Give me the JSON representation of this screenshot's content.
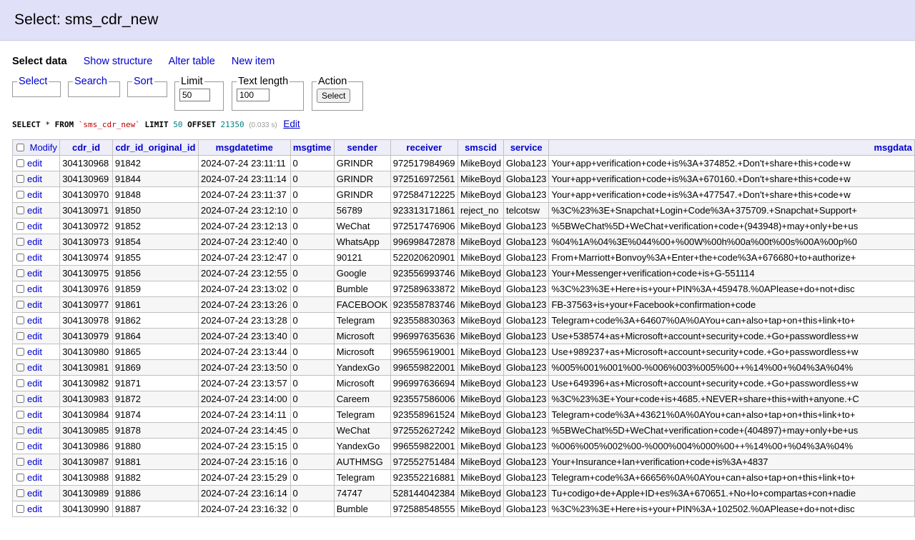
{
  "header": {
    "title": "Select: sms_cdr_new"
  },
  "nav": {
    "current": "Select data",
    "links": [
      "Show structure",
      "Alter table",
      "New item"
    ]
  },
  "fieldsets": {
    "select": "Select",
    "search": "Search",
    "sort": "Sort",
    "limit": {
      "label": "Limit",
      "value": "50"
    },
    "text_length": {
      "label": "Text length",
      "value": "100"
    },
    "action": {
      "label": "Action",
      "button": "Select"
    }
  },
  "query": {
    "kw_select": "SELECT",
    "star": "*",
    "kw_from": "FROM",
    "table": "`sms_cdr_new`",
    "kw_limit": "LIMIT",
    "limit": "50",
    "kw_offset": "OFFSET",
    "offset": "21350",
    "time": "(0.033 s)",
    "edit": "Edit"
  },
  "table": {
    "modify_label": "Modify",
    "edit_label": "edit",
    "columns": [
      "cdr_id",
      "cdr_id_original_id",
      "msgdatetime",
      "msgtime",
      "sender",
      "receiver",
      "smscid",
      "service",
      "msgdata"
    ],
    "rows": [
      [
        "304130968",
        "91842",
        "2024-07-24 23:11:11",
        "0",
        "GRINDR",
        "972517984969",
        "MikeBoyd",
        "Globa123",
        "Your+app+verification+code+is%3A+374852.+Don't+share+this+code+w"
      ],
      [
        "304130969",
        "91844",
        "2024-07-24 23:11:14",
        "0",
        "GRINDR",
        "972516972561",
        "MikeBoyd",
        "Globa123",
        "Your+app+verification+code+is%3A+670160.+Don't+share+this+code+w"
      ],
      [
        "304130970",
        "91848",
        "2024-07-24 23:11:37",
        "0",
        "GRINDR",
        "972584712225",
        "MikeBoyd",
        "Globa123",
        "Your+app+verification+code+is%3A+477547.+Don't+share+this+code+w"
      ],
      [
        "304130971",
        "91850",
        "2024-07-24 23:12:10",
        "0",
        "56789",
        "923313171861",
        "reject_no",
        "telcotsw",
        "%3C%23%3E+Snapchat+Login+Code%3A+375709.+Snapchat+Support+"
      ],
      [
        "304130972",
        "91852",
        "2024-07-24 23:12:13",
        "0",
        "WeChat",
        "972517476906",
        "MikeBoyd",
        "Globa123",
        "%5BWeChat%5D+WeChat+verification+code+(943948)+may+only+be+us"
      ],
      [
        "304130973",
        "91854",
        "2024-07-24 23:12:40",
        "0",
        "WhatsApp",
        "996998472878",
        "MikeBoyd",
        "Globa123",
        "%04%1A%04%3E%044%00+%00W%00h%00a%00t%00s%00A%00p%0"
      ],
      [
        "304130974",
        "91855",
        "2024-07-24 23:12:47",
        "0",
        "90121",
        "522020620901",
        "MikeBoyd",
        "Globa123",
        "From+Marriott+Bonvoy%3A+Enter+the+code%3A+676680+to+authorize+"
      ],
      [
        "304130975",
        "91856",
        "2024-07-24 23:12:55",
        "0",
        "Google",
        "923556993746",
        "MikeBoyd",
        "Globa123",
        "Your+Messenger+verification+code+is+G-551114"
      ],
      [
        "304130976",
        "91859",
        "2024-07-24 23:13:02",
        "0",
        "Bumble",
        "972589633872",
        "MikeBoyd",
        "Globa123",
        "%3C%23%3E+Here+is+your+PIN%3A+459478.%0APlease+do+not+disc"
      ],
      [
        "304130977",
        "91861",
        "2024-07-24 23:13:26",
        "0",
        "FACEBOOK",
        "923558783746",
        "MikeBoyd",
        "Globa123",
        "FB-37563+is+your+Facebook+confirmation+code"
      ],
      [
        "304130978",
        "91862",
        "2024-07-24 23:13:28",
        "0",
        "Telegram",
        "923558830363",
        "MikeBoyd",
        "Globa123",
        "Telegram+code%3A+64607%0A%0AYou+can+also+tap+on+this+link+to+"
      ],
      [
        "304130979",
        "91864",
        "2024-07-24 23:13:40",
        "0",
        "Microsoft",
        "996997635636",
        "MikeBoyd",
        "Globa123",
        "Use+538574+as+Microsoft+account+security+code.+Go+passwordless+w"
      ],
      [
        "304130980",
        "91865",
        "2024-07-24 23:13:44",
        "0",
        "Microsoft",
        "996559619001",
        "MikeBoyd",
        "Globa123",
        "Use+989237+as+Microsoft+account+security+code.+Go+passwordless+w"
      ],
      [
        "304130981",
        "91869",
        "2024-07-24 23:13:50",
        "0",
        "YandexGo",
        "996559822001",
        "MikeBoyd",
        "Globa123",
        "%005%001%001%00-%006%003%005%00++%14%00+%04%3A%04%"
      ],
      [
        "304130982",
        "91871",
        "2024-07-24 23:13:57",
        "0",
        "Microsoft",
        "996997636694",
        "MikeBoyd",
        "Globa123",
        "Use+649396+as+Microsoft+account+security+code.+Go+passwordless+w"
      ],
      [
        "304130983",
        "91872",
        "2024-07-24 23:14:00",
        "0",
        "Careem",
        "923557586006",
        "MikeBoyd",
        "Globa123",
        "%3C%23%3E+Your+code+is+4685.+NEVER+share+this+with+anyone.+C"
      ],
      [
        "304130984",
        "91874",
        "2024-07-24 23:14:11",
        "0",
        "Telegram",
        "923558961524",
        "MikeBoyd",
        "Globa123",
        "Telegram+code%3A+43621%0A%0AYou+can+also+tap+on+this+link+to+"
      ],
      [
        "304130985",
        "91878",
        "2024-07-24 23:14:45",
        "0",
        "WeChat",
        "972552627242",
        "MikeBoyd",
        "Globa123",
        "%5BWeChat%5D+WeChat+verification+code+(404897)+may+only+be+us"
      ],
      [
        "304130986",
        "91880",
        "2024-07-24 23:15:15",
        "0",
        "YandexGo",
        "996559822001",
        "MikeBoyd",
        "Globa123",
        "%006%005%002%00-%000%004%000%00++%14%00+%04%3A%04%"
      ],
      [
        "304130987",
        "91881",
        "2024-07-24 23:15:16",
        "0",
        "AUTHMSG",
        "972552751484",
        "MikeBoyd",
        "Globa123",
        "Your+Insurance+Ian+verification+code+is%3A+4837"
      ],
      [
        "304130988",
        "91882",
        "2024-07-24 23:15:29",
        "0",
        "Telegram",
        "923552216881",
        "MikeBoyd",
        "Globa123",
        "Telegram+code%3A+66656%0A%0AYou+can+also+tap+on+this+link+to+"
      ],
      [
        "304130989",
        "91886",
        "2024-07-24 23:16:14",
        "0",
        "74747",
        "528144042384",
        "MikeBoyd",
        "Globa123",
        "Tu+codigo+de+Apple+ID+es%3A+670651.+No+lo+compartas+con+nadie"
      ],
      [
        "304130990",
        "91887",
        "2024-07-24 23:16:32",
        "0",
        "Bumble",
        "972588548555",
        "MikeBoyd",
        "Globa123",
        "%3C%23%3E+Here+is+your+PIN%3A+102502.%0APlease+do+not+disc"
      ]
    ]
  }
}
